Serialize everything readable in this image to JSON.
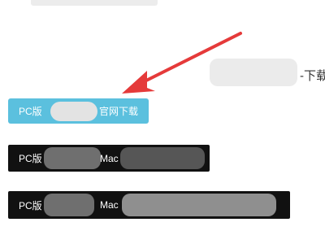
{
  "colors": {
    "accent": "#5bc0de",
    "dark_button": "#111111",
    "arrow": "#e53a3a"
  },
  "header": {
    "download_suffix": "-下载"
  },
  "buttons": {
    "official": {
      "prefix": "PC版",
      "suffix": "官网下载"
    },
    "row1": {
      "prefix": "PC版",
      "mac_label": "Mac"
    },
    "row2": {
      "prefix": "PC版",
      "mac_label": "Mac"
    }
  },
  "annotation": {
    "icon": "red-arrow-icon"
  }
}
